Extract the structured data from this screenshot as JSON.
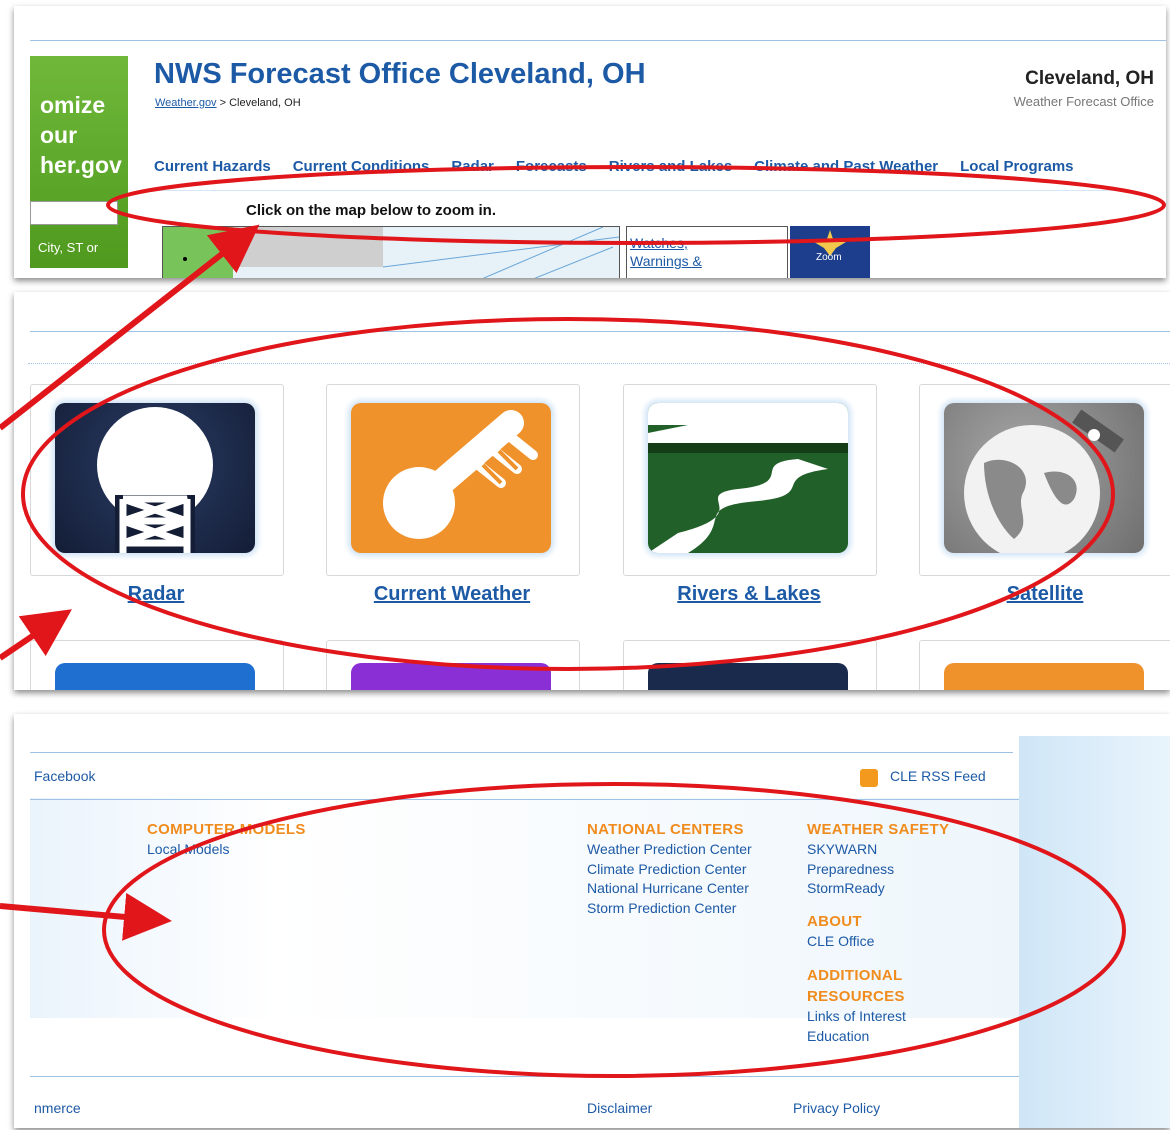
{
  "header": {
    "promo_line1": "omize",
    "promo_line2": "our",
    "promo_line3": "her.gov",
    "promo_location_hint": "City, ST or",
    "office_title": "NWS Forecast Office Cleveland, OH",
    "breadcrumb_link": "Weather.gov",
    "breadcrumb_sep": " > ",
    "breadcrumb_current": "Cleveland, OH",
    "right_title": "Cleveland, OH",
    "right_subtitle": "Weather Forecast Office"
  },
  "nav": {
    "items": [
      "Current Hazards",
      "Current Conditions",
      "Radar",
      "Forecasts",
      "Rivers and Lakes",
      "Climate and Past Weather",
      "Local Programs"
    ]
  },
  "map": {
    "hint": "Click on the map below to zoom in.",
    "watch_text_1": "Watches,",
    "watch_text_2": "Warnings &",
    "zoom_label": "Zoom"
  },
  "tiles": {
    "items": [
      {
        "label": "Radar",
        "icon": "radar-tower-icon",
        "color": "#1a2a4c"
      },
      {
        "label": "Current Weather",
        "icon": "thermometer-icon",
        "color": "#f0922c"
      },
      {
        "label": "Rivers & Lakes",
        "icon": "river-icon",
        "color": "#22602a"
      },
      {
        "label": "Satellite",
        "icon": "satellite-icon",
        "color": "#8c8c8c"
      }
    ]
  },
  "footer": {
    "social": "Facebook",
    "rss": "CLE RSS Feed",
    "computer_models": {
      "heading": "COMPUTER MODELS",
      "links": [
        "Local Models"
      ]
    },
    "national_centers": {
      "heading": "NATIONAL CENTERS",
      "links": [
        "Weather Prediction Center",
        "Climate Prediction Center",
        "National Hurricane Center",
        "Storm Prediction Center"
      ]
    },
    "weather_safety": {
      "heading": "WEATHER SAFETY",
      "links": [
        "SKYWARN",
        "Preparedness",
        "StormReady"
      ]
    },
    "about": {
      "heading": "ABOUT",
      "links": [
        "CLE Office"
      ]
    },
    "additional": {
      "heading_1": "ADDITIONAL",
      "heading_2": "RESOURCES",
      "links": [
        "Links of Interest",
        "Education"
      ]
    },
    "bottom_left": "nmerce",
    "disclaimer": "Disclaimer",
    "privacy": "Privacy Policy"
  },
  "colors": {
    "link": "#1d5aa6",
    "heading_orange": "#f08c1e",
    "annotation_red": "#e0161a"
  }
}
